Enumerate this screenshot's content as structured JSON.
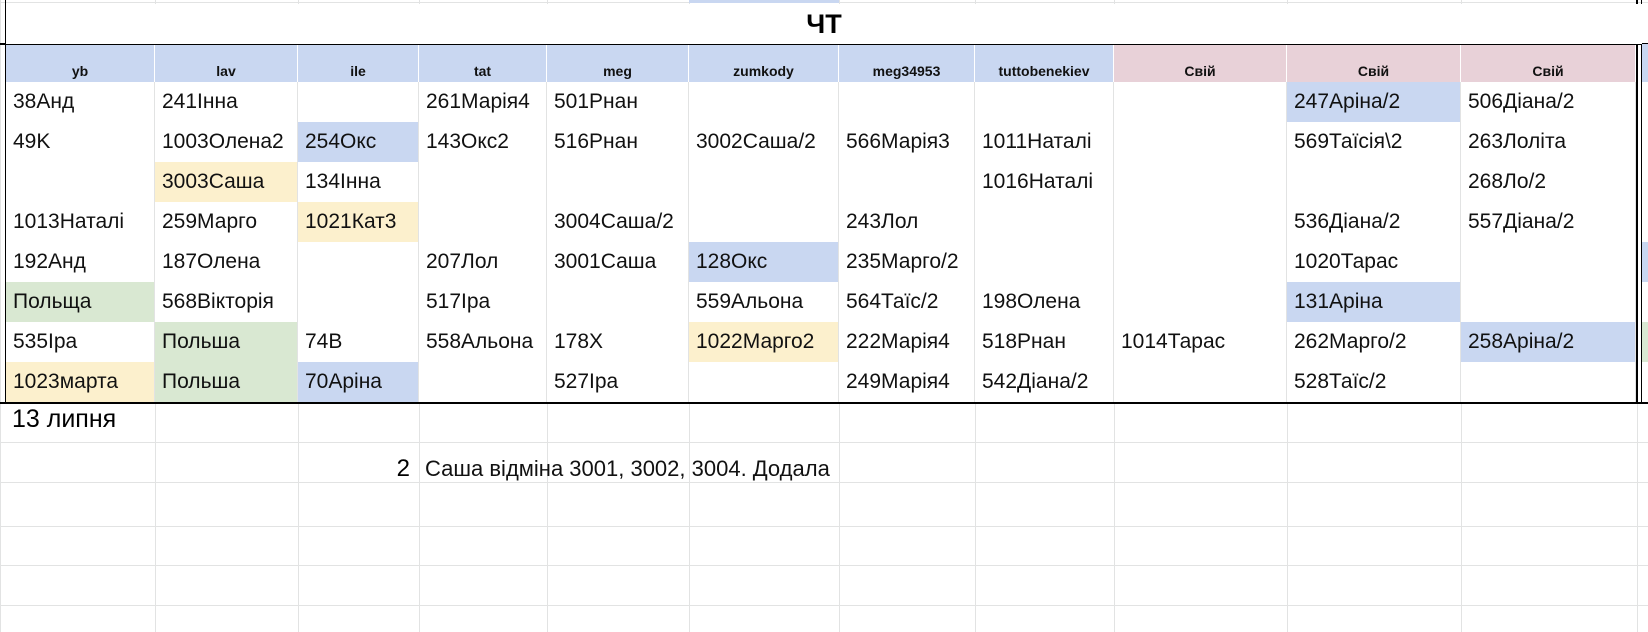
{
  "colors": {
    "blue": "#c9d7f1",
    "yellow": "#fcf0cd",
    "green": "#d9e8d2",
    "pink": "#e8d1d8",
    "grid": "#e2e3e3",
    "border": "#000000"
  },
  "sheet": {
    "title": "ЧТ",
    "headers": [
      {
        "label": "yb",
        "color": "blue"
      },
      {
        "label": "lav",
        "color": "blue"
      },
      {
        "label": "ile",
        "color": "blue"
      },
      {
        "label": "tat",
        "color": "blue"
      },
      {
        "label": "meg",
        "color": "blue"
      },
      {
        "label": "zumkody",
        "color": "blue"
      },
      {
        "label": "meg34953",
        "color": "blue"
      },
      {
        "label": "tuttobenekiev",
        "color": "blue"
      },
      {
        "label": "Свій",
        "color": "pink"
      },
      {
        "label": "Свій",
        "color": "pink"
      },
      {
        "label": "Свій",
        "color": "pink"
      }
    ],
    "rows": [
      [
        {
          "t": "38Анд"
        },
        {
          "t": "241Інна"
        },
        {
          "t": ""
        },
        {
          "t": "261Марія4"
        },
        {
          "t": "501Рнан"
        },
        {
          "t": ""
        },
        {
          "t": ""
        },
        {
          "t": ""
        },
        {
          "t": ""
        },
        {
          "t": "247Аріна/2",
          "c": "blue"
        },
        {
          "t": "506Діана/2"
        }
      ],
      [
        {
          "t": "49K"
        },
        {
          "t": "1003Олена2"
        },
        {
          "t": "254Окс",
          "c": "blue"
        },
        {
          "t": "143Окс2"
        },
        {
          "t": "516Рнан"
        },
        {
          "t": "3002Саша/2"
        },
        {
          "t": "566Марія3"
        },
        {
          "t": "1011Наталі"
        },
        {
          "t": ""
        },
        {
          "t": "569Таїсія\\2"
        },
        {
          "t": "263Лоліта"
        }
      ],
      [
        {
          "t": ""
        },
        {
          "t": "3003Саша",
          "c": "yellow"
        },
        {
          "t": "134Інна"
        },
        {
          "t": ""
        },
        {
          "t": ""
        },
        {
          "t": ""
        },
        {
          "t": ""
        },
        {
          "t": "1016Наталі"
        },
        {
          "t": ""
        },
        {
          "t": ""
        },
        {
          "t": "268Ло/2"
        }
      ],
      [
        {
          "t": "1013Наталі"
        },
        {
          "t": "259Марго"
        },
        {
          "t": "1021Кат3",
          "c": "yellow"
        },
        {
          "t": ""
        },
        {
          "t": "3004Саша/2"
        },
        {
          "t": ""
        },
        {
          "t": "243Лол"
        },
        {
          "t": ""
        },
        {
          "t": ""
        },
        {
          "t": "536Діана/2"
        },
        {
          "t": "557Діана/2"
        }
      ],
      [
        {
          "t": "192Анд"
        },
        {
          "t": "187Олена"
        },
        {
          "t": ""
        },
        {
          "t": "207Лол"
        },
        {
          "t": "3001Саша"
        },
        {
          "t": "128Окс",
          "c": "blue"
        },
        {
          "t": "235Марго/2"
        },
        {
          "t": ""
        },
        {
          "t": ""
        },
        {
          "t": "1020Тарас"
        },
        {
          "t": ""
        }
      ],
      [
        {
          "t": "Польща",
          "c": "green"
        },
        {
          "t": "568Вікторія"
        },
        {
          "t": ""
        },
        {
          "t": "517Іра"
        },
        {
          "t": ""
        },
        {
          "t": "559Альона"
        },
        {
          "t": "564Таїс/2"
        },
        {
          "t": "198Олена"
        },
        {
          "t": ""
        },
        {
          "t": "131Аріна",
          "c": "blue"
        },
        {
          "t": ""
        }
      ],
      [
        {
          "t": "535Іра"
        },
        {
          "t": "Польша",
          "c": "green"
        },
        {
          "t": "74B"
        },
        {
          "t": "558Альона"
        },
        {
          "t": "178X"
        },
        {
          "t": "1022Марго2",
          "c": "yellow"
        },
        {
          "t": "222Марія4"
        },
        {
          "t": "518Рнан"
        },
        {
          "t": "1014Тарас"
        },
        {
          "t": "262Марго/2"
        },
        {
          "t": "258Аріна/2",
          "c": "blue"
        }
      ],
      [
        {
          "t": "1023марта",
          "c": "yellow"
        },
        {
          "t": "Польша",
          "c": "green"
        },
        {
          "t": "70Аріна",
          "c": "blue"
        },
        {
          "t": ""
        },
        {
          "t": "527Іра"
        },
        {
          "t": ""
        },
        {
          "t": "249Марія4"
        },
        {
          "t": "542Діана/2"
        },
        {
          "t": ""
        },
        {
          "t": "528Таїс/2"
        },
        {
          "t": ""
        }
      ]
    ]
  },
  "footer": {
    "date_label": "13 липня",
    "note_number": "2",
    "note_text": "Саша відміна 3001, 3002, 3004. Додала"
  }
}
